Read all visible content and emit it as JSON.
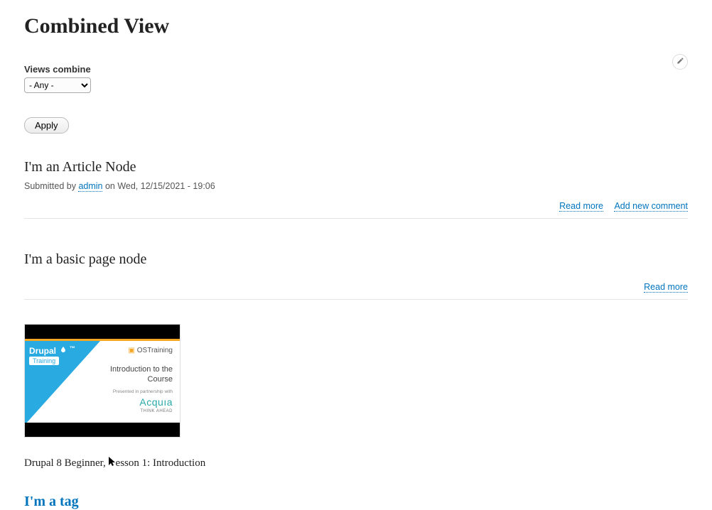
{
  "page": {
    "title": "Combined View"
  },
  "filter": {
    "label": "Views combine",
    "selected": "- Any -",
    "apply_label": "Apply"
  },
  "rows": {
    "article": {
      "title": "I'm an Article Node",
      "submitted_prefix": "Submitted by ",
      "author": "admin",
      "submitted_suffix": " on Wed, 12/15/2021 - 19:06",
      "read_more": "Read more",
      "add_comment": "Add new comment"
    },
    "page": {
      "title": "I'm a basic page node",
      "read_more": "Read more"
    },
    "video": {
      "brand": "Drupal",
      "training_badge": "Training",
      "ostraining": "OSTraining",
      "intro": "Introduction to the Course",
      "partner": "Presented in partnership with",
      "acquia": "Acquıa",
      "acquia_tag": "THINK AHEAD",
      "caption_a": "Drupal 8 Beginner, ",
      "caption_b": "esson 1: Introduction"
    },
    "tag": {
      "label": "I'm a tag"
    }
  }
}
